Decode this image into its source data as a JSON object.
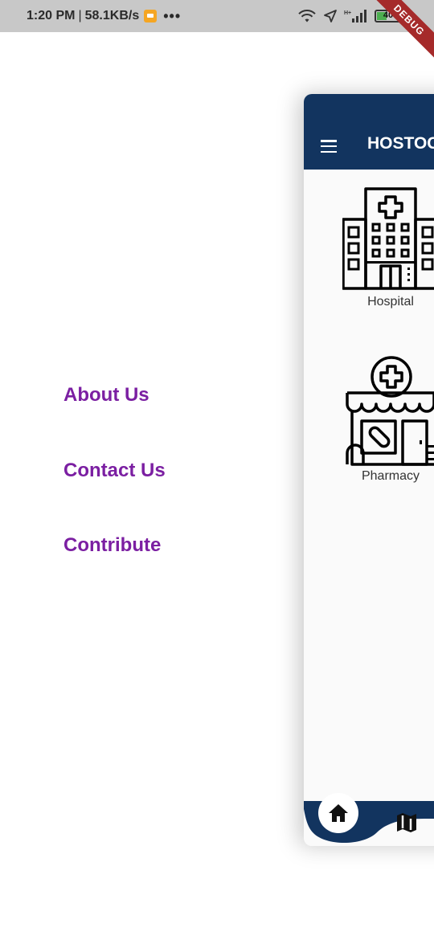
{
  "status_bar": {
    "time": "1:20 PM",
    "separator": "|",
    "network_speed": "58.1KB/s",
    "more_dots": "•••",
    "network_type": "H+",
    "battery": "40",
    "debug_banner": "DEBUG"
  },
  "drawer": {
    "items": [
      {
        "label": "About Us"
      },
      {
        "label": "Contact Us"
      },
      {
        "label": "Contribute"
      }
    ],
    "label_color": "#7b1fa2"
  },
  "app": {
    "title": "HOSTOC",
    "app_bar_color": "#12345f",
    "tiles": [
      {
        "label": "Hospital",
        "icon": "hospital-icon"
      },
      {
        "label": "Pharmacy",
        "icon": "pharmacy-icon"
      }
    ],
    "bottom_nav": [
      {
        "icon": "home-icon"
      },
      {
        "icon": "map-icon"
      }
    ]
  }
}
